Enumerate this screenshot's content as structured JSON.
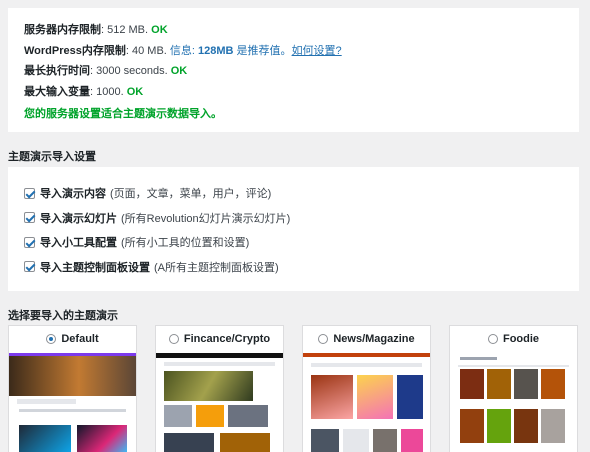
{
  "server": {
    "rows": [
      {
        "label": "服务器内存限制",
        "value": ": 512 MB.",
        "status": "OK"
      },
      {
        "label": "WordPress内存限制",
        "value": ": 40 MB.",
        "info_prefix": "信息: ",
        "info_strong": "128MB",
        "info_suffix": " 是推荐值。",
        "link": "如何设置?"
      },
      {
        "label": "最长执行时间",
        "value": ": 3000 seconds.",
        "status": "OK"
      },
      {
        "label": "最大输入变量",
        "value": ": 1000.",
        "status": "OK"
      }
    ],
    "summary": "您的服务器设置适合主题演示数据导入。"
  },
  "import_settings": {
    "title": "主题演示导入设置",
    "options": [
      {
        "name": "导入演示内容",
        "desc": "(页面，文章，菜单，用户，评论)",
        "checked": true
      },
      {
        "name": "导入演示幻灯片",
        "desc": "(所有Revolution幻灯片演示幻灯片)",
        "checked": true
      },
      {
        "name": "导入小工具配置",
        "desc": "(所有小工具的位置和设置)",
        "checked": true
      },
      {
        "name": "导入主题控制面板设置",
        "desc": "(A所有主题控制面板设置)",
        "checked": true
      }
    ]
  },
  "demo_select": {
    "title": "选择要导入的主题演示",
    "demos": [
      {
        "label": "Default",
        "selected": true,
        "accent": "#7c3aed"
      },
      {
        "label": "Fincance/Crypto",
        "selected": false,
        "accent": "#111111"
      },
      {
        "label": "News/Magazine",
        "selected": false,
        "accent": "#c2410c"
      },
      {
        "label": "Foodie",
        "selected": false,
        "accent": "#6b7280"
      }
    ]
  },
  "colors": {
    "ok": "#00a32a",
    "link": "#2271b1",
    "checkbox": "#2271b1"
  }
}
